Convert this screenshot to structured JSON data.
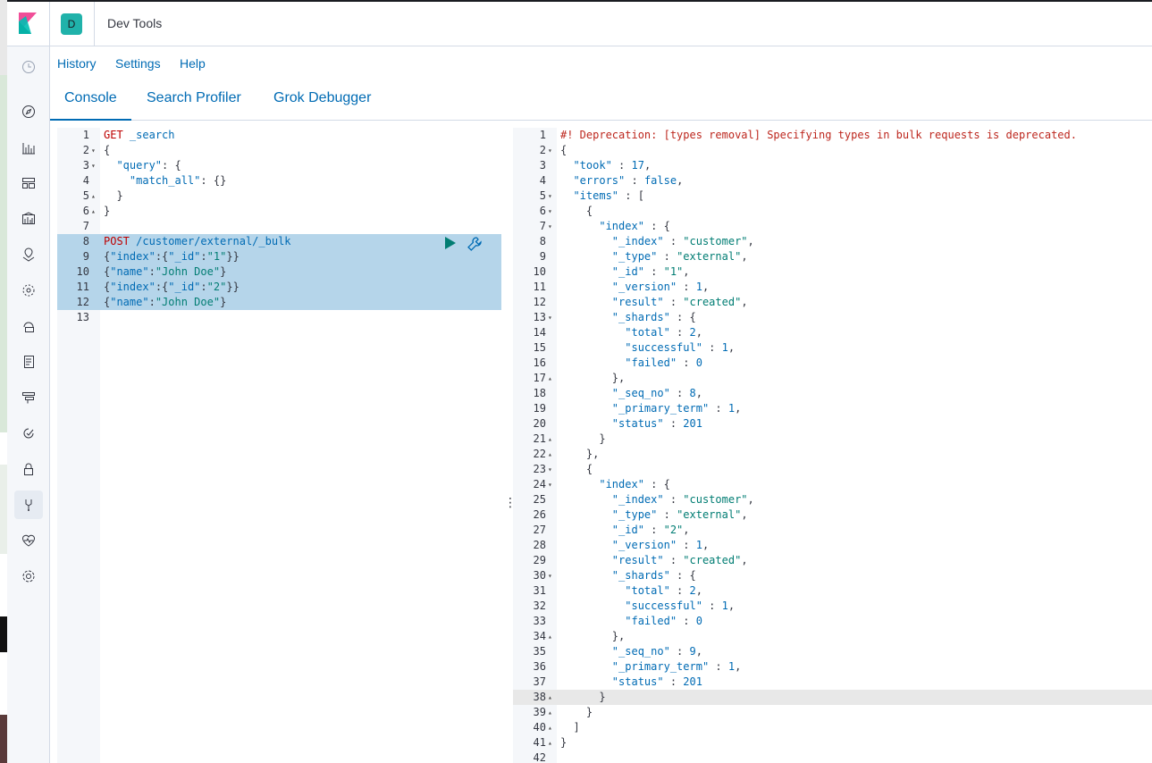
{
  "app": {
    "title": "Dev Tools",
    "space_initial": "D"
  },
  "colors": {
    "accent": "#006bb4",
    "space_avatar": "#20b2aa",
    "selection": "#b5d5ea",
    "play": "#017d73"
  },
  "sidenav": {
    "icons": [
      "recently-viewed-icon",
      "discover-icon",
      "visualize-icon",
      "dashboard-icon",
      "canvas-icon",
      "maps-icon",
      "machine-learning-icon",
      "infrastructure-icon",
      "logs-icon",
      "apm-icon",
      "uptime-icon",
      "security-icon",
      "dev-tools-icon",
      "monitoring-icon",
      "management-icon"
    ]
  },
  "menu": {
    "history": "History",
    "settings": "Settings",
    "help": "Help"
  },
  "tabs": {
    "console": "Console",
    "search_profiler": "Search Profiler",
    "grok_debugger": "Grok Debugger"
  },
  "request_editor": {
    "line_numbers": [
      "1",
      "2",
      "3",
      "4",
      "5",
      "6",
      "7",
      "8",
      "9",
      "10",
      "11",
      "12",
      "13"
    ],
    "lines": [
      "GET _search",
      "{",
      "  \"query\": {",
      "    \"match_all\": {}",
      "  }",
      "}",
      "",
      "POST /customer/external/_bulk",
      "{\"index\":{\"_id\":\"1\"}}",
      "{\"name\":\"John Doe\"}",
      "{\"index\":{\"_id\":\"2\"}}",
      "{\"name\":\"John Doe\"}",
      ""
    ]
  },
  "response_editor": {
    "line_numbers": [
      "1",
      "2",
      "3",
      "4",
      "5",
      "6",
      "7",
      "8",
      "9",
      "10",
      "11",
      "12",
      "13",
      "14",
      "15",
      "16",
      "17",
      "18",
      "19",
      "20",
      "21",
      "22",
      "23",
      "24",
      "25",
      "26",
      "27",
      "28",
      "29",
      "30",
      "31",
      "32",
      "33",
      "34",
      "35",
      "36",
      "37",
      "38",
      "39",
      "40",
      "41",
      "42"
    ],
    "lines": [
      "#! Deprecation: [types removal] Specifying types in bulk requests is deprecated.",
      "{",
      "  \"took\" : 17,",
      "  \"errors\" : false,",
      "  \"items\" : [",
      "    {",
      "      \"index\" : {",
      "        \"_index\" : \"customer\",",
      "        \"_type\" : \"external\",",
      "        \"_id\" : \"1\",",
      "        \"_version\" : 1,",
      "        \"result\" : \"created\",",
      "        \"_shards\" : {",
      "          \"total\" : 2,",
      "          \"successful\" : 1,",
      "          \"failed\" : 0",
      "        },",
      "        \"_seq_no\" : 8,",
      "        \"_primary_term\" : 1,",
      "        \"status\" : 201",
      "      }",
      "    },",
      "    {",
      "      \"index\" : {",
      "        \"_index\" : \"customer\",",
      "        \"_type\" : \"external\",",
      "        \"_id\" : \"2\",",
      "        \"_version\" : 1,",
      "        \"result\" : \"created\",",
      "        \"_shards\" : {",
      "          \"total\" : 2,",
      "          \"successful\" : 1,",
      "          \"failed\" : 0",
      "        },",
      "        \"_seq_no\" : 9,",
      "        \"_primary_term\" : 1,",
      "        \"status\" : 201",
      "      }",
      "    }",
      "  ]",
      "}",
      ""
    ]
  }
}
